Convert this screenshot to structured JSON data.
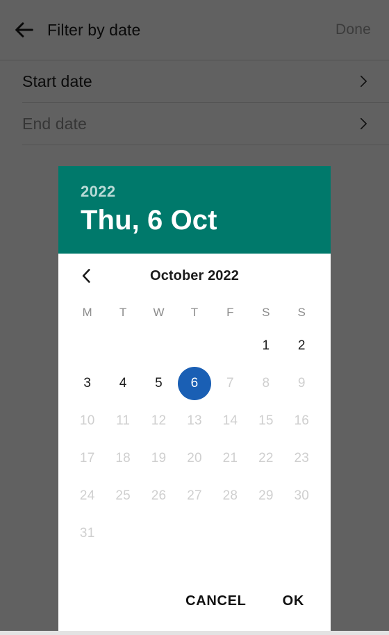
{
  "appbar": {
    "back_icon": "arrow-left-icon",
    "title": "Filter by date",
    "action_label": "Done",
    "action_enabled": false
  },
  "filter_list": {
    "rows": [
      {
        "label": "Start date",
        "chevron_icon": "chevron-right-icon",
        "muted": false
      },
      {
        "label": "End date",
        "chevron_icon": "chevron-right-icon",
        "muted": true
      }
    ]
  },
  "date_picker": {
    "header": {
      "year": "2022",
      "selected_date": "Thu, 6 Oct",
      "background_color": "#00796b"
    },
    "month_nav": {
      "prev_icon": "chevron-left-icon",
      "month_label": "October 2022"
    },
    "weekday_headers": [
      "M",
      "T",
      "W",
      "T",
      "F",
      "S",
      "S"
    ],
    "selected_day": 6,
    "accent_color": "#1a5fb4",
    "weeks": [
      [
        {
          "label": "",
          "state": "blank"
        },
        {
          "label": "",
          "state": "blank"
        },
        {
          "label": "",
          "state": "blank"
        },
        {
          "label": "",
          "state": "blank"
        },
        {
          "label": "",
          "state": "blank"
        },
        {
          "label": "1",
          "state": "enabled"
        },
        {
          "label": "2",
          "state": "enabled"
        }
      ],
      [
        {
          "label": "3",
          "state": "enabled"
        },
        {
          "label": "4",
          "state": "enabled"
        },
        {
          "label": "5",
          "state": "enabled"
        },
        {
          "label": "6",
          "state": "selected"
        },
        {
          "label": "7",
          "state": "disabled"
        },
        {
          "label": "8",
          "state": "disabled"
        },
        {
          "label": "9",
          "state": "disabled"
        }
      ],
      [
        {
          "label": "10",
          "state": "disabled"
        },
        {
          "label": "11",
          "state": "disabled"
        },
        {
          "label": "12",
          "state": "disabled"
        },
        {
          "label": "13",
          "state": "disabled"
        },
        {
          "label": "14",
          "state": "disabled"
        },
        {
          "label": "15",
          "state": "disabled"
        },
        {
          "label": "16",
          "state": "disabled"
        }
      ],
      [
        {
          "label": "17",
          "state": "disabled"
        },
        {
          "label": "18",
          "state": "disabled"
        },
        {
          "label": "19",
          "state": "disabled"
        },
        {
          "label": "20",
          "state": "disabled"
        },
        {
          "label": "21",
          "state": "disabled"
        },
        {
          "label": "22",
          "state": "disabled"
        },
        {
          "label": "23",
          "state": "disabled"
        }
      ],
      [
        {
          "label": "24",
          "state": "disabled"
        },
        {
          "label": "25",
          "state": "disabled"
        },
        {
          "label": "26",
          "state": "disabled"
        },
        {
          "label": "27",
          "state": "disabled"
        },
        {
          "label": "28",
          "state": "disabled"
        },
        {
          "label": "29",
          "state": "disabled"
        },
        {
          "label": "30",
          "state": "disabled"
        }
      ],
      [
        {
          "label": "31",
          "state": "disabled"
        },
        {
          "label": "",
          "state": "blank"
        },
        {
          "label": "",
          "state": "blank"
        },
        {
          "label": "",
          "state": "blank"
        },
        {
          "label": "",
          "state": "blank"
        },
        {
          "label": "",
          "state": "blank"
        },
        {
          "label": "",
          "state": "blank"
        }
      ]
    ],
    "actions": {
      "cancel_label": "CANCEL",
      "ok_label": "OK"
    }
  }
}
